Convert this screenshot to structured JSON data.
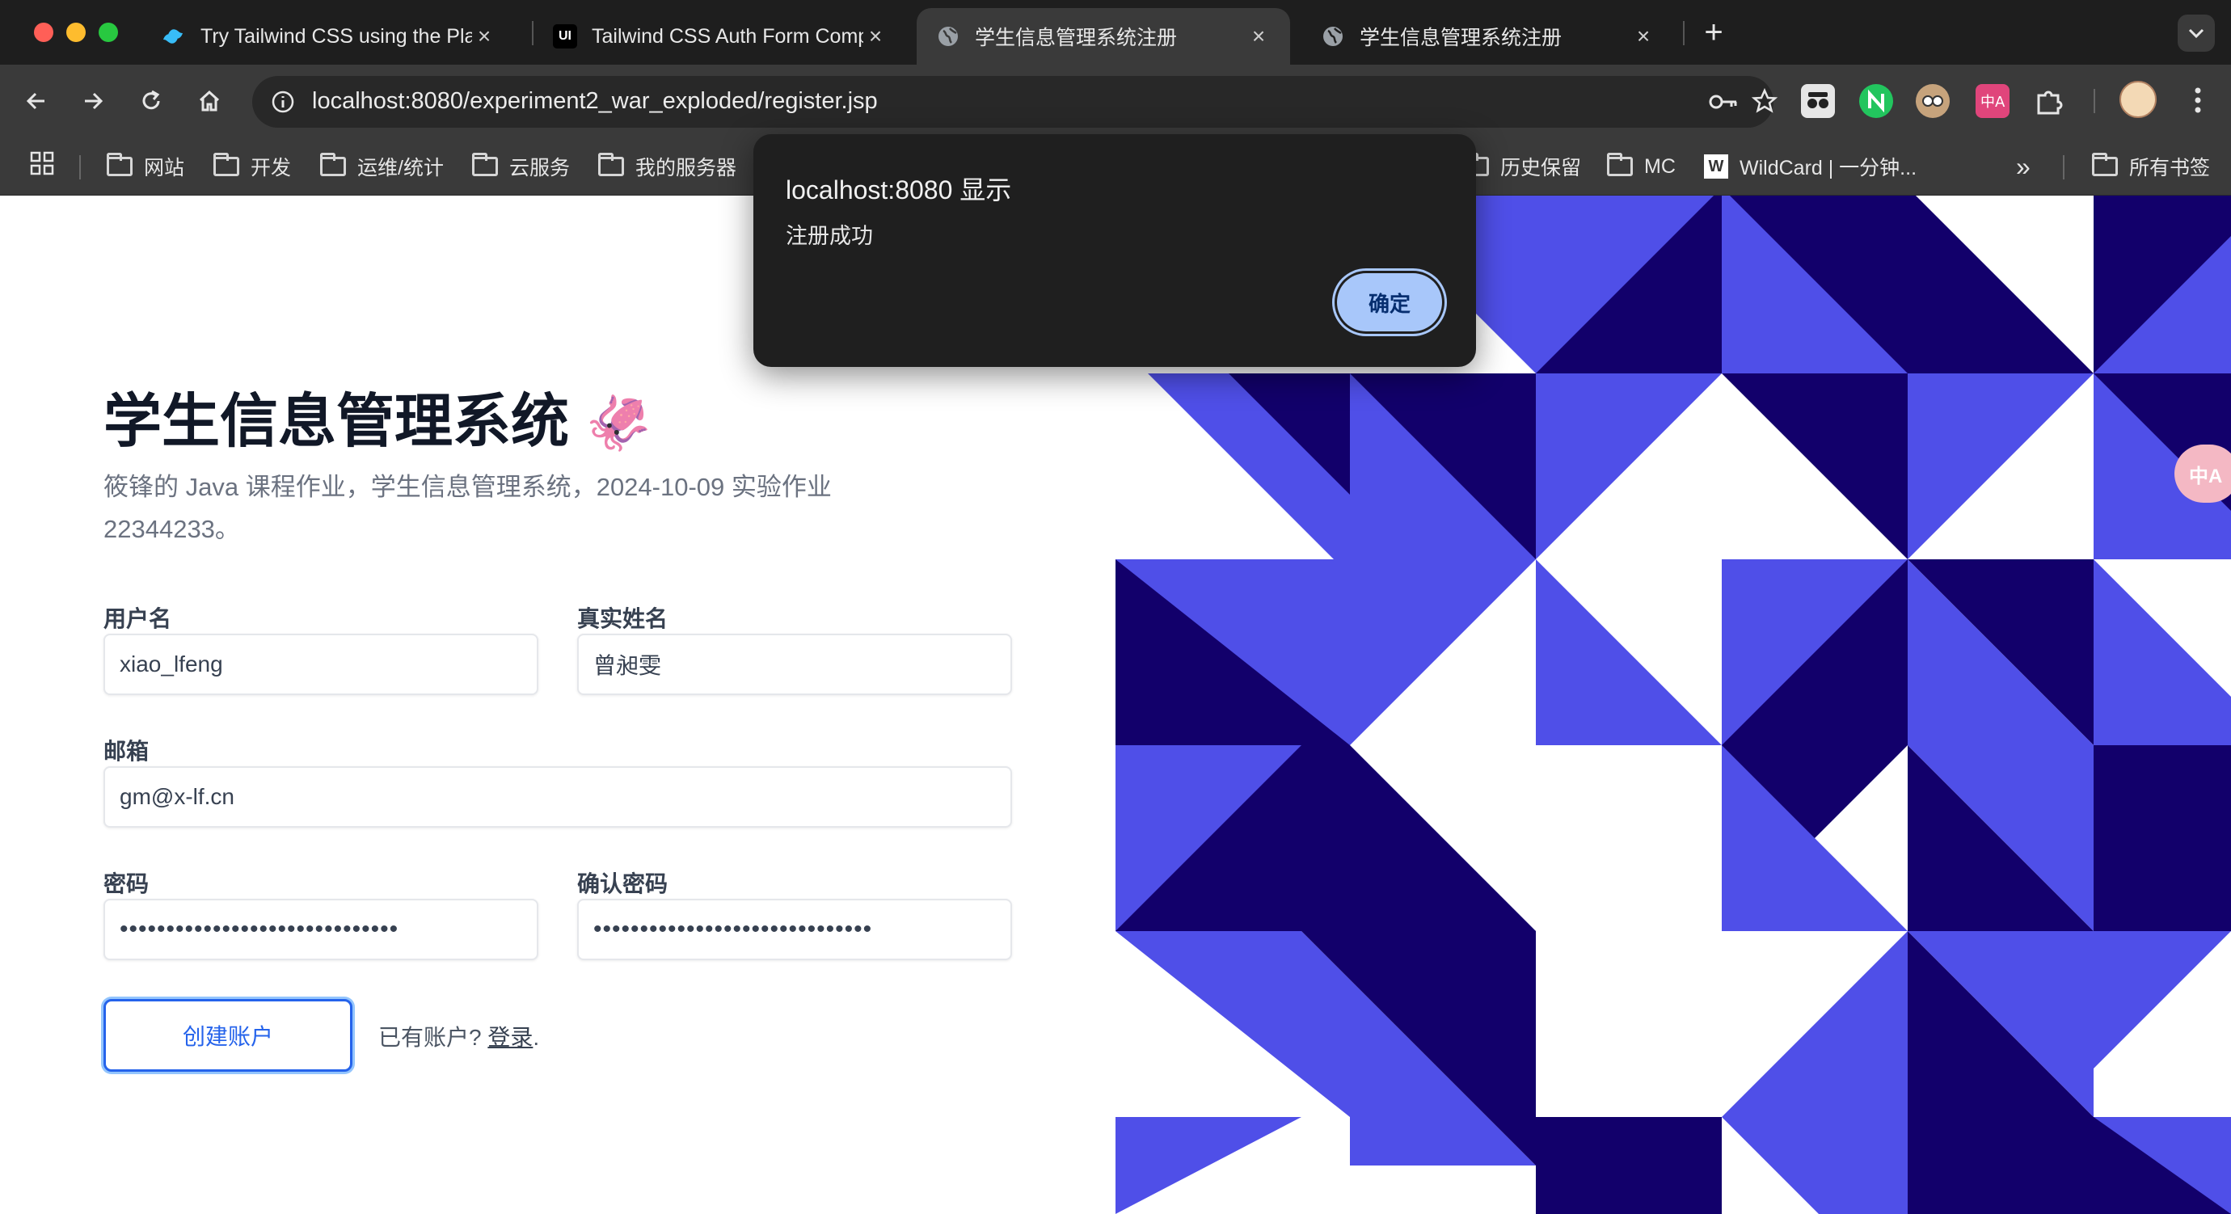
{
  "browser": {
    "tabs": [
      {
        "title": "Try Tailwind CSS using the Pla",
        "icon": "tailwind-icon",
        "active": false
      },
      {
        "title": "Tailwind CSS Auth Form Comp",
        "icon": "tailwind-ui-icon",
        "active": false
      },
      {
        "title": "学生信息管理系统注册",
        "icon": "globe-icon",
        "active": true
      },
      {
        "title": "学生信息管理系统注册",
        "icon": "globe-icon",
        "active": false
      }
    ],
    "tailwind_ui_badge": "UI",
    "url": "localhost:8080/experiment2_war_exploded/register.jsp",
    "bookmarks": [
      {
        "label": "网站"
      },
      {
        "label": "开发"
      },
      {
        "label": "运维/统计"
      },
      {
        "label": "云服务"
      },
      {
        "label": "我的服务器"
      },
      {
        "label": "历史保留"
      },
      {
        "label": "MC"
      },
      {
        "label": "WildCard | 一分钟..."
      }
    ],
    "wildcard_badge": "W",
    "all_bookmarks": "所有书签",
    "overflow": "»"
  },
  "page": {
    "title": "学生信息管理系统",
    "title_emoji": "🦑",
    "subtitle": "筱锋的 Java 课程作业，学生信息管理系统，2024-10-09 实验作业 22344233。",
    "form": {
      "username_label": "用户名",
      "username_value": "xiao_lfeng",
      "realname_label": "真实姓名",
      "realname_value": "曾昶雯",
      "email_label": "邮箱",
      "email_value": "gm@x-lf.cn",
      "password_label": "密码",
      "password_value": "••••••••••••••••••••••••••••••",
      "confirm_label": "确认密码",
      "confirm_value": "••••••••••••••••••••••••••••••",
      "create_button": "创建账户",
      "have_account": "已有账户?",
      "login_link": "登录",
      "period": "."
    },
    "translate_float": "中A"
  },
  "dialog": {
    "title": "localhost:8080 显示",
    "message": "注册成功",
    "ok_button": "确定"
  },
  "colors": {
    "indigo": "#4f4fe8",
    "navy": "#12006b",
    "accent": "#2563eb"
  }
}
